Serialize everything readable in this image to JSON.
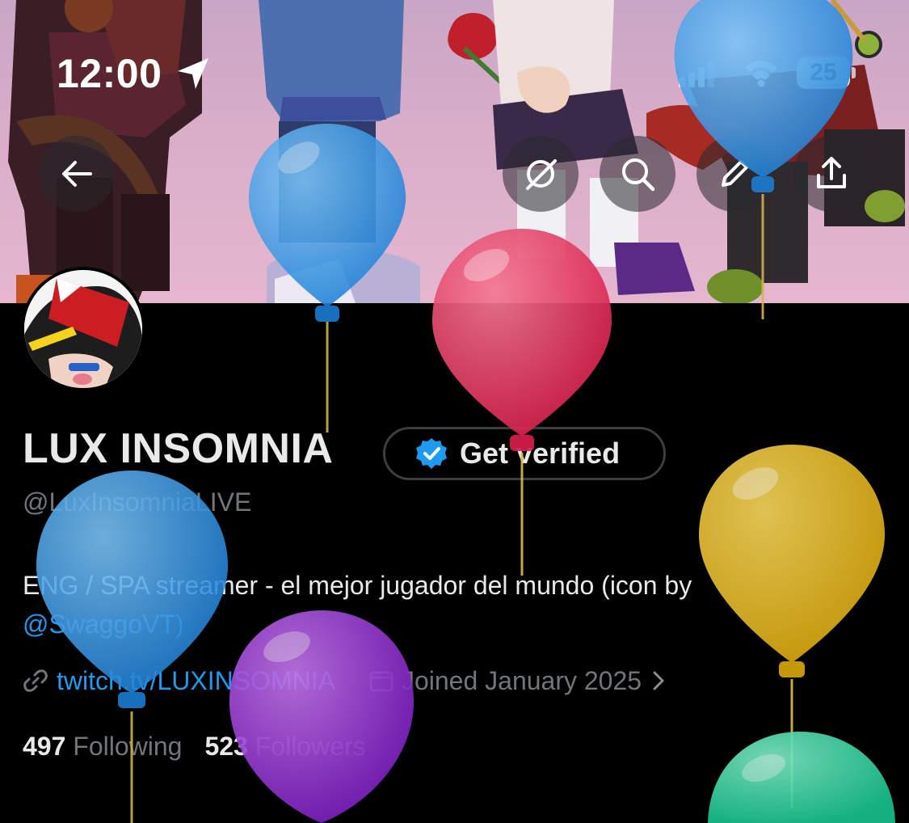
{
  "status_bar": {
    "time": "12:00",
    "battery": "25",
    "icons": [
      "location-arrow-icon",
      "cellular-signal-icon",
      "wifi-icon",
      "battery-icon"
    ]
  },
  "nav": {
    "icons": [
      "back-arrow-icon",
      "grok-icon",
      "search-icon",
      "edit-pencil-icon",
      "share-icon"
    ]
  },
  "profile": {
    "name": "LUX INSOMNIA",
    "verify_label": "Get verified",
    "handle": "@LuxInsomniaLIVE",
    "bio_text": "ENG / SPA streamer - el mejor jugador del mundo (icon by",
    "bio_mention": "@SwaggoVT)",
    "website": "twitch.tv/LUXINSOMNIA",
    "joined": "Joined January 2025",
    "following_count": "497",
    "following_label": "Following",
    "followers_count": "523",
    "followers_label": "Followers"
  },
  "colors": {
    "accent": "#1d9bf0",
    "muted": "#71767b",
    "text": "#e7e9ea",
    "background": "#000000",
    "balloon_blue": "#3a9ce8",
    "balloon_pink": "#e23a64",
    "balloon_yellow": "#e0b21a",
    "balloon_purple": "#9a35d0",
    "balloon_green": "#2fd6a0"
  }
}
